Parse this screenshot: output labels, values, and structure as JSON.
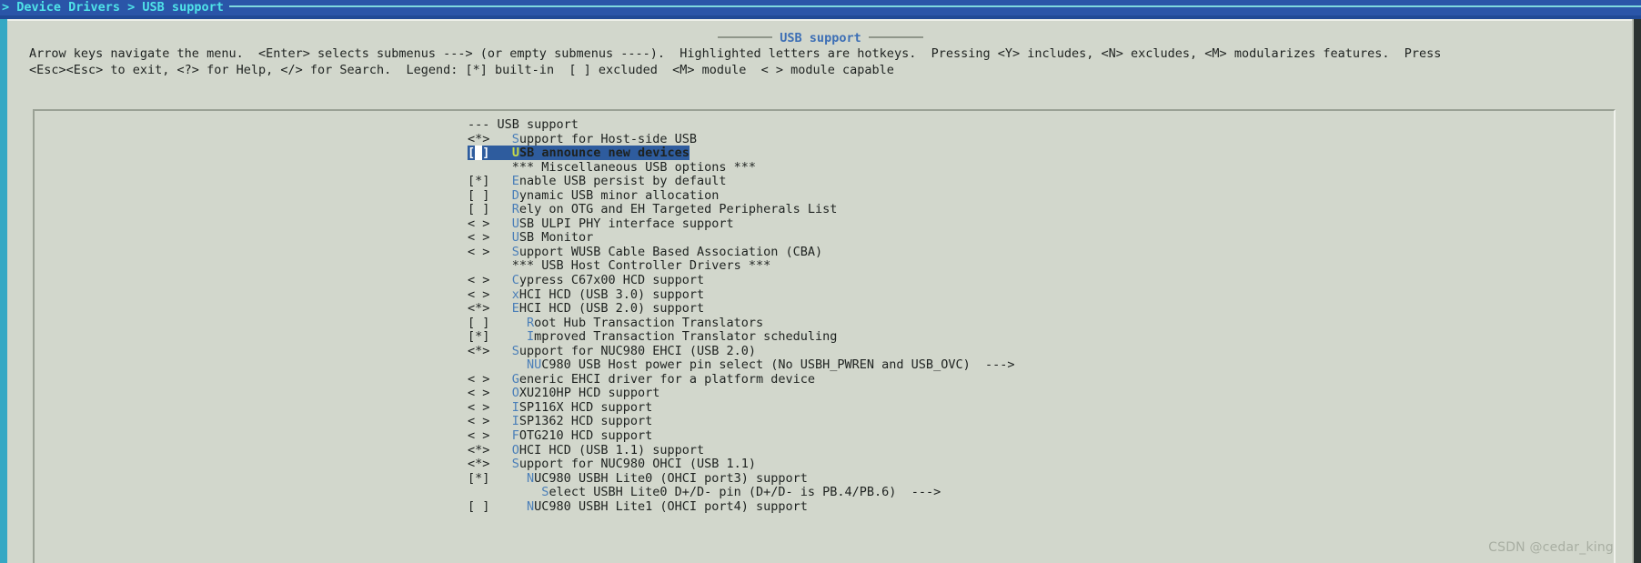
{
  "window": {
    "breadcrumb": "> Device Drivers > USB support",
    "dialog_title": "USB support"
  },
  "help": {
    "line1": "Arrow keys navigate the menu.  <Enter> selects submenus ---> (or empty submenus ----).  Highlighted letters are hotkeys.  Pressing <Y> includes, <N> excludes, <M> modularizes features.  Press",
    "line2": "<Esc><Esc> to exit, <?> for Help, </> for Search.  Legend: [*] built-in  [ ] excluded  <M> module  < > module capable"
  },
  "colors": {
    "titlebar_bg": "#2a55a8",
    "titlebar_fg": "#4fe3e8",
    "panel_bg": "#d2d7cc",
    "dialog_title_fg": "#3d6fb5",
    "hotkey_fg": "#4b7fb8",
    "selected_bg": "#2e5c9e",
    "selected_fg": "#ffffff",
    "selected_hotkey_fg": "#c6d94a",
    "text_fg": "#1e2220"
  },
  "menu": {
    "items": [
      {
        "marker": "--- ",
        "indent": "",
        "hotkey": "",
        "label": "USB support",
        "selected": false,
        "type": "comment"
      },
      {
        "marker": "<*>",
        "indent": "   ",
        "hotkey": "S",
        "label": "upport for Host-side USB",
        "selected": false,
        "type": "bool"
      },
      {
        "marker": "[ ]",
        "indent": "   ",
        "hotkey": "U",
        "label": "SB announce new devices",
        "selected": true,
        "type": "bool"
      },
      {
        "marker": "   ",
        "indent": "   ",
        "hotkey": "",
        "label": "*** Miscellaneous USB options ***",
        "selected": false,
        "type": "comment"
      },
      {
        "marker": "[*]",
        "indent": "   ",
        "hotkey": "E",
        "label": "nable USB persist by default",
        "selected": false,
        "type": "bool"
      },
      {
        "marker": "[ ]",
        "indent": "   ",
        "hotkey": "D",
        "label": "ynamic USB minor allocation",
        "selected": false,
        "type": "bool"
      },
      {
        "marker": "[ ]",
        "indent": "   ",
        "hotkey": "R",
        "label": "ely on OTG and EH Targeted Peripherals List",
        "selected": false,
        "type": "bool"
      },
      {
        "marker": "< >",
        "indent": "   ",
        "hotkey": "U",
        "label": "SB ULPI PHY interface support",
        "selected": false,
        "type": "tristate"
      },
      {
        "marker": "< >",
        "indent": "   ",
        "hotkey": "U",
        "label": "SB Monitor",
        "selected": false,
        "type": "tristate"
      },
      {
        "marker": "< >",
        "indent": "   ",
        "hotkey": "S",
        "label": "upport WUSB Cable Based Association (CBA)",
        "selected": false,
        "type": "tristate"
      },
      {
        "marker": "   ",
        "indent": "   ",
        "hotkey": "",
        "label": "*** USB Host Controller Drivers ***",
        "selected": false,
        "type": "comment"
      },
      {
        "marker": "< >",
        "indent": "   ",
        "hotkey": "C",
        "label": "ypress C67x00 HCD support",
        "selected": false,
        "type": "tristate"
      },
      {
        "marker": "< >",
        "indent": "   ",
        "hotkey": "x",
        "label": "HCI HCD (USB 3.0) support",
        "selected": false,
        "type": "tristate"
      },
      {
        "marker": "<*>",
        "indent": "   ",
        "hotkey": "E",
        "label": "HCI HCD (USB 2.0) support",
        "selected": false,
        "type": "tristate"
      },
      {
        "marker": "[ ]",
        "indent": "     ",
        "hotkey": "R",
        "label": "oot Hub Transaction Translators",
        "selected": false,
        "type": "bool"
      },
      {
        "marker": "[*]",
        "indent": "     ",
        "hotkey": "I",
        "label": "mproved Transaction Translator scheduling",
        "selected": false,
        "type": "bool"
      },
      {
        "marker": "<*>",
        "indent": "   ",
        "hotkey": "S",
        "label": "upport for NUC980 EHCI (USB 2.0)",
        "selected": false,
        "type": "tristate"
      },
      {
        "marker": "   ",
        "indent": "     ",
        "hotkey": "NU",
        "label": "C980 USB Host power pin select (No USBH_PWREN and USB_OVC)  --->",
        "selected": false,
        "type": "choice"
      },
      {
        "marker": "< >",
        "indent": "   ",
        "hotkey": "G",
        "label": "eneric EHCI driver for a platform device",
        "selected": false,
        "type": "tristate"
      },
      {
        "marker": "< >",
        "indent": "   ",
        "hotkey": "O",
        "label": "XU210HP HCD support",
        "selected": false,
        "type": "tristate"
      },
      {
        "marker": "< >",
        "indent": "   ",
        "hotkey": "I",
        "label": "SP116X HCD support",
        "selected": false,
        "type": "tristate"
      },
      {
        "marker": "< >",
        "indent": "   ",
        "hotkey": "I",
        "label": "SP1362 HCD support",
        "selected": false,
        "type": "tristate"
      },
      {
        "marker": "< >",
        "indent": "   ",
        "hotkey": "F",
        "label": "OTG210 HCD support",
        "selected": false,
        "type": "tristate"
      },
      {
        "marker": "<*>",
        "indent": "   ",
        "hotkey": "O",
        "label": "HCI HCD (USB 1.1) support",
        "selected": false,
        "type": "tristate"
      },
      {
        "marker": "<*>",
        "indent": "   ",
        "hotkey": "S",
        "label": "upport for NUC980 OHCI (USB 1.1)",
        "selected": false,
        "type": "tristate"
      },
      {
        "marker": "[*]",
        "indent": "     ",
        "hotkey": "N",
        "label": "UC980 USBH Lite0 (OHCI port3) support",
        "selected": false,
        "type": "bool"
      },
      {
        "marker": "   ",
        "indent": "       ",
        "hotkey": "S",
        "label": "elect USBH Lite0 D+/D- pin (D+/D- is PB.4/PB.6)  --->",
        "selected": false,
        "type": "choice"
      },
      {
        "marker": "[ ]",
        "indent": "     ",
        "hotkey": "N",
        "label": "UC980 USBH Lite1 (OHCI port4) support",
        "selected": false,
        "type": "bool"
      }
    ]
  },
  "watermark": {
    "text": "CSDN @cedar_king"
  }
}
